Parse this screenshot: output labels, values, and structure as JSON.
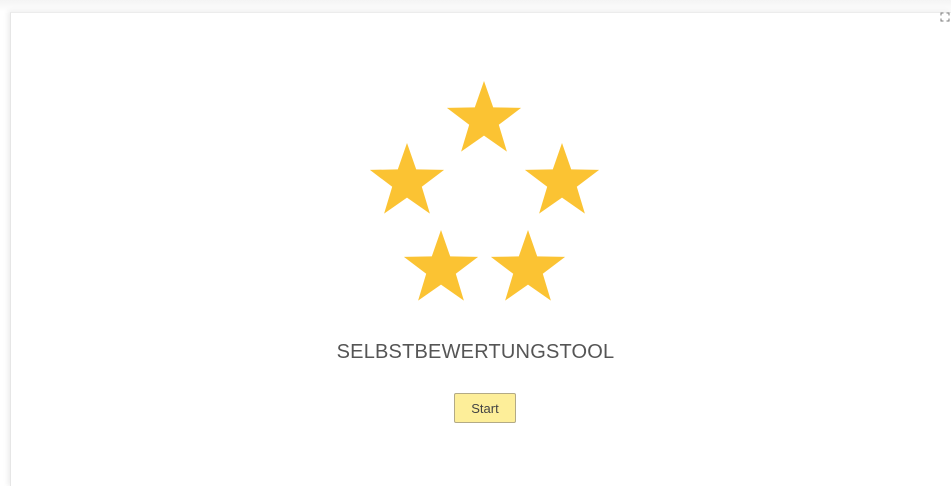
{
  "app": {
    "title": "SELBSTBEWERTUNGSTOOL",
    "start_label": "Start"
  },
  "icons": {
    "fullscreen": "fullscreen-icon",
    "star": "star-icon"
  },
  "colors": {
    "star": "#fbc333",
    "button_bg": "#fdee99",
    "button_border": "#b3aa86",
    "title_text": "#555555"
  }
}
